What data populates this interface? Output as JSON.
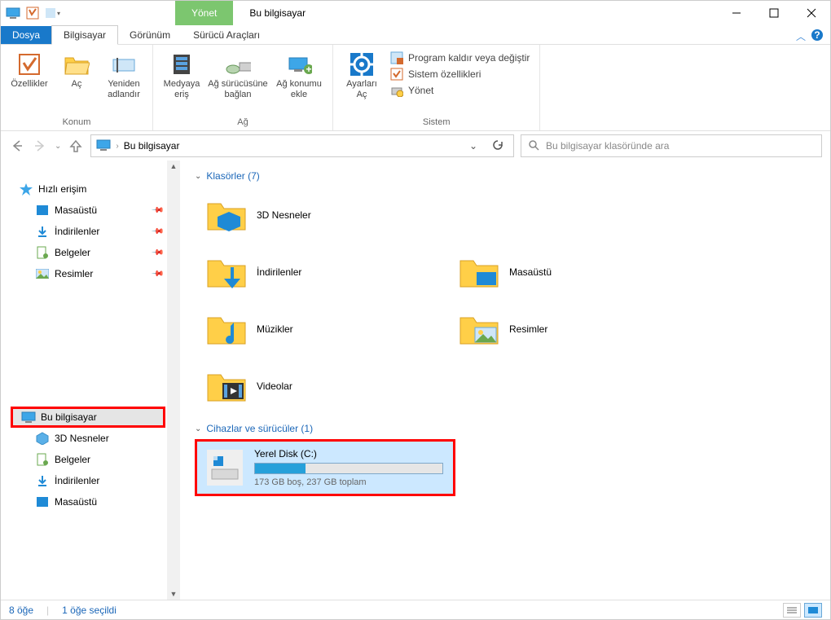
{
  "titlebar": {
    "contextual_tab": "Yönet",
    "title": "Bu bilgisayar"
  },
  "tabs": {
    "file": "Dosya",
    "computer": "Bilgisayar",
    "view": "Görünüm",
    "drive_tools": "Sürücü Araçları"
  },
  "ribbon": {
    "group_location": "Konum",
    "group_network": "Ağ",
    "group_system": "Sistem",
    "properties": "Özellikler",
    "open": "Aç",
    "rename": "Yeniden\nadlandır",
    "media_access": "Medyaya\neriş",
    "map_drive": "Ağ sürücüsüne\nbağlan",
    "add_net_loc": "Ağ konumu\nekle",
    "open_settings": "Ayarları\nAç",
    "uninstall": "Program kaldır veya değiştir",
    "sys_props": "Sistem özellikleri",
    "manage": "Yönet"
  },
  "nav": {
    "breadcrumb": "Bu bilgisayar",
    "search_placeholder": "Bu bilgisayar klasöründe ara"
  },
  "tree": {
    "quick_access": "Hızlı erişim",
    "desktop": "Masaüstü",
    "downloads": "İndirilenler",
    "documents": "Belgeler",
    "pictures": "Resimler",
    "this_pc": "Bu bilgisayar",
    "objects3d": "3D Nesneler",
    "documents2": "Belgeler",
    "downloads2": "İndirilenler",
    "desktop2": "Masaüstü"
  },
  "content": {
    "folders_header": "Klasörler (7)",
    "drives_header": "Cihazlar ve sürücüler (1)",
    "folder_3d": "3D Nesneler",
    "folder_downloads": "İndirilenler",
    "folder_desktop": "Masaüstü",
    "folder_music": "Müzikler",
    "folder_pictures": "Resimler",
    "folder_videos": "Videolar",
    "drive_name": "Yerel Disk (C:)",
    "drive_sub": "173 GB boş, 237 GB toplam"
  },
  "status": {
    "count": "8 öğe",
    "selected": "1 öğe seçildi"
  }
}
